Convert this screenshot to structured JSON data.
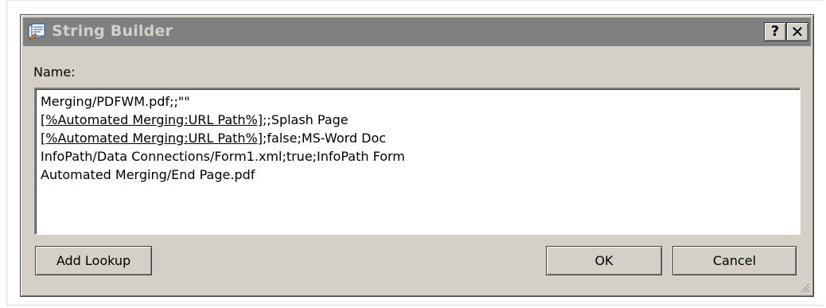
{
  "dialog": {
    "title": "String Builder",
    "help_label": "?",
    "close_label": "✕"
  },
  "form": {
    "name_label": "Name:",
    "lines": [
      {
        "lookup": "",
        "text": "Merging/PDFWM.pdf;;\"\""
      },
      {
        "lookup": "[%Automated Merging:URL Path%]",
        "text": ";;Splash Page"
      },
      {
        "lookup": "[%Automated Merging:URL Path%]",
        "text": ";false;MS-Word Doc"
      },
      {
        "lookup": "",
        "text": "InfoPath/Data Connections/Form1.xml;true;InfoPath Form"
      },
      {
        "lookup": "",
        "text": "Automated Merging/End Page.pdf"
      }
    ]
  },
  "buttons": {
    "add_lookup": "Add Lookup",
    "ok": "OK",
    "cancel": "Cancel"
  },
  "icons": {
    "title_icon": "string-builder-icon",
    "resize_grip": "resize-grip-icon"
  }
}
